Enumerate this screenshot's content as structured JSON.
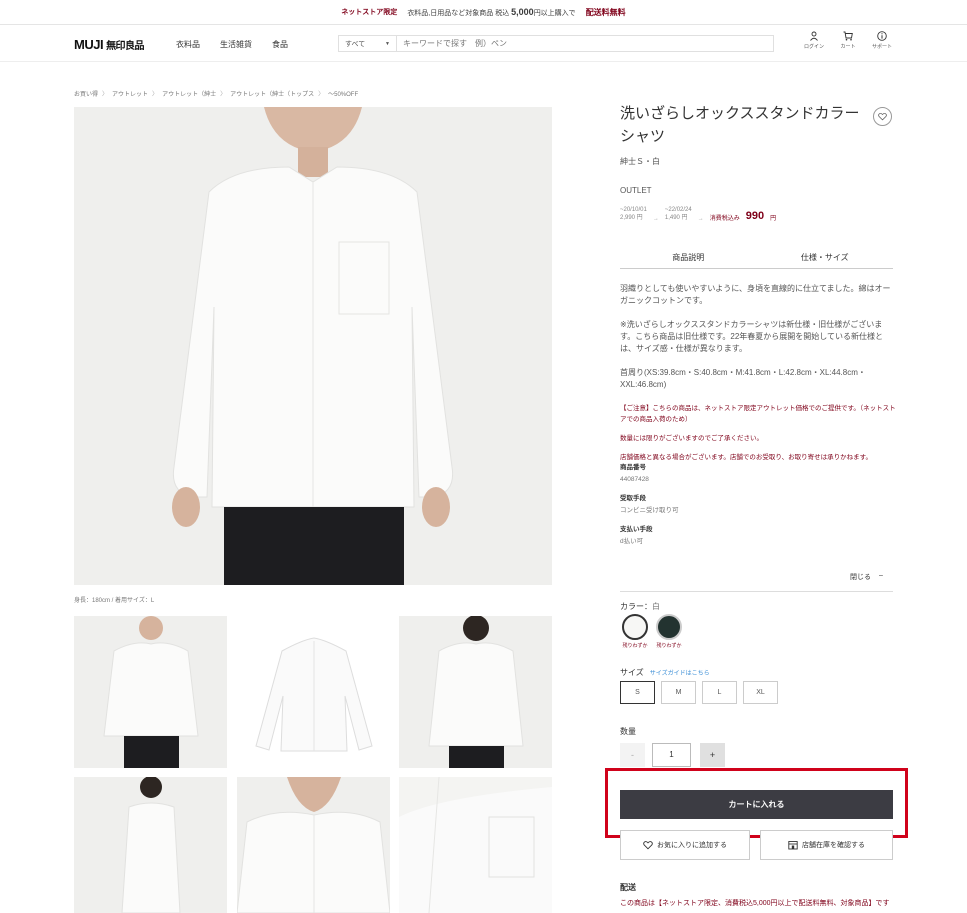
{
  "banner": {
    "tag": "ネットストア限定",
    "message_pre": "衣料品,日用品など対象商品 税込",
    "message_amount": "5,000",
    "message_post": "円以上購入で",
    "free": "配送料無料"
  },
  "header": {
    "logo": "MUJI",
    "logo_jp": "無印良品",
    "nav": [
      "衣料品",
      "生活雑貨",
      "食品"
    ],
    "search_category": "すべて",
    "search_placeholder": "キーワードで探す　例）ペン",
    "icons": [
      {
        "label": "ログイン",
        "icon": "user-icon"
      },
      {
        "label": "カート",
        "icon": "cart-icon"
      },
      {
        "label": "サポート",
        "icon": "info-icon"
      }
    ]
  },
  "breadcrumb": [
    "お買い得",
    "アウトレット",
    "アウトレット（紳士",
    "アウトレット（紳士（トップス",
    "～50%OFF"
  ],
  "main_caption": "身長：180cm / 着用サイズ：L",
  "product": {
    "title": "洗いざらしオックススタンドカラーシャツ",
    "subtitle": "紳士Ｓ・白",
    "outlet": "OUTLET",
    "price1_date": "~20/10/01",
    "price1": "2,990 円",
    "price2_date": "~22/02/24",
    "price2": "1,490 円",
    "arrow": "→",
    "final_label": "消費税込み",
    "final_price": "990",
    "final_unit": "円"
  },
  "tabs": [
    "商品説明",
    "仕様・サイズ"
  ],
  "description": {
    "p1": "羽織りとしても使いやすいように、身頃を直線的に仕立てました。綿はオーガニックコットンです。",
    "p2": "※洗いざらしオックススタンドカラーシャツは新仕様・旧仕様がございます。こちら商品は旧仕様です。22年春夏から展開を開始している新仕様とは、サイズ感・仕様が異なります。",
    "p3": "首周り(XS:39.8cm・S:40.8cm・M:41.8cm・L:42.8cm・XL:44.8cm・XXL:46.8cm)",
    "warn1": "【ご注意】こちらの商品は、ネットストア限定アウトレット価格でのご提供です。（ネットストアでの商品入荷のため）",
    "warn2": "数量には限りがございますのでご了承ください。",
    "warn3": "店舗価格と異なる場合がございます。店舗でのお受取り、お取り寄せは承りかねます。",
    "product_no_label": "商品番号",
    "product_no": "44087428",
    "receive_label": "受取手段",
    "receive": "コンビニ受け取り可",
    "pay_label": "支払い手段",
    "pay": "d払い可"
  },
  "close_label": "閉じる",
  "close_icon": "–",
  "color": {
    "label": "カラー：",
    "value": "白",
    "swatches": [
      {
        "note": "残りわずか",
        "color": "#f7f7f5"
      },
      {
        "note": "残りわずか",
        "color": "#233330"
      }
    ]
  },
  "size": {
    "label": "サイズ",
    "guide": "サイズガイドはこちら",
    "options": [
      "S",
      "M",
      "L",
      "XL"
    ],
    "selected": "S"
  },
  "quantity": {
    "label": "数量",
    "minus": "-",
    "value": "1",
    "plus": "+"
  },
  "cart_button": "カートに入れる",
  "favorite_button": "お気に入りに追加する",
  "store_button": "店舗在庫を確認する",
  "delivery": {
    "label": "配送",
    "text": "この商品は【ネットストア限定、消費税込5,000円以上で配送料無料、対象商品】です"
  },
  "colors": {
    "accent": "#7f0019",
    "button": "#3c3c43",
    "highlight": "#d0021b",
    "link": "#3b8ed6"
  }
}
